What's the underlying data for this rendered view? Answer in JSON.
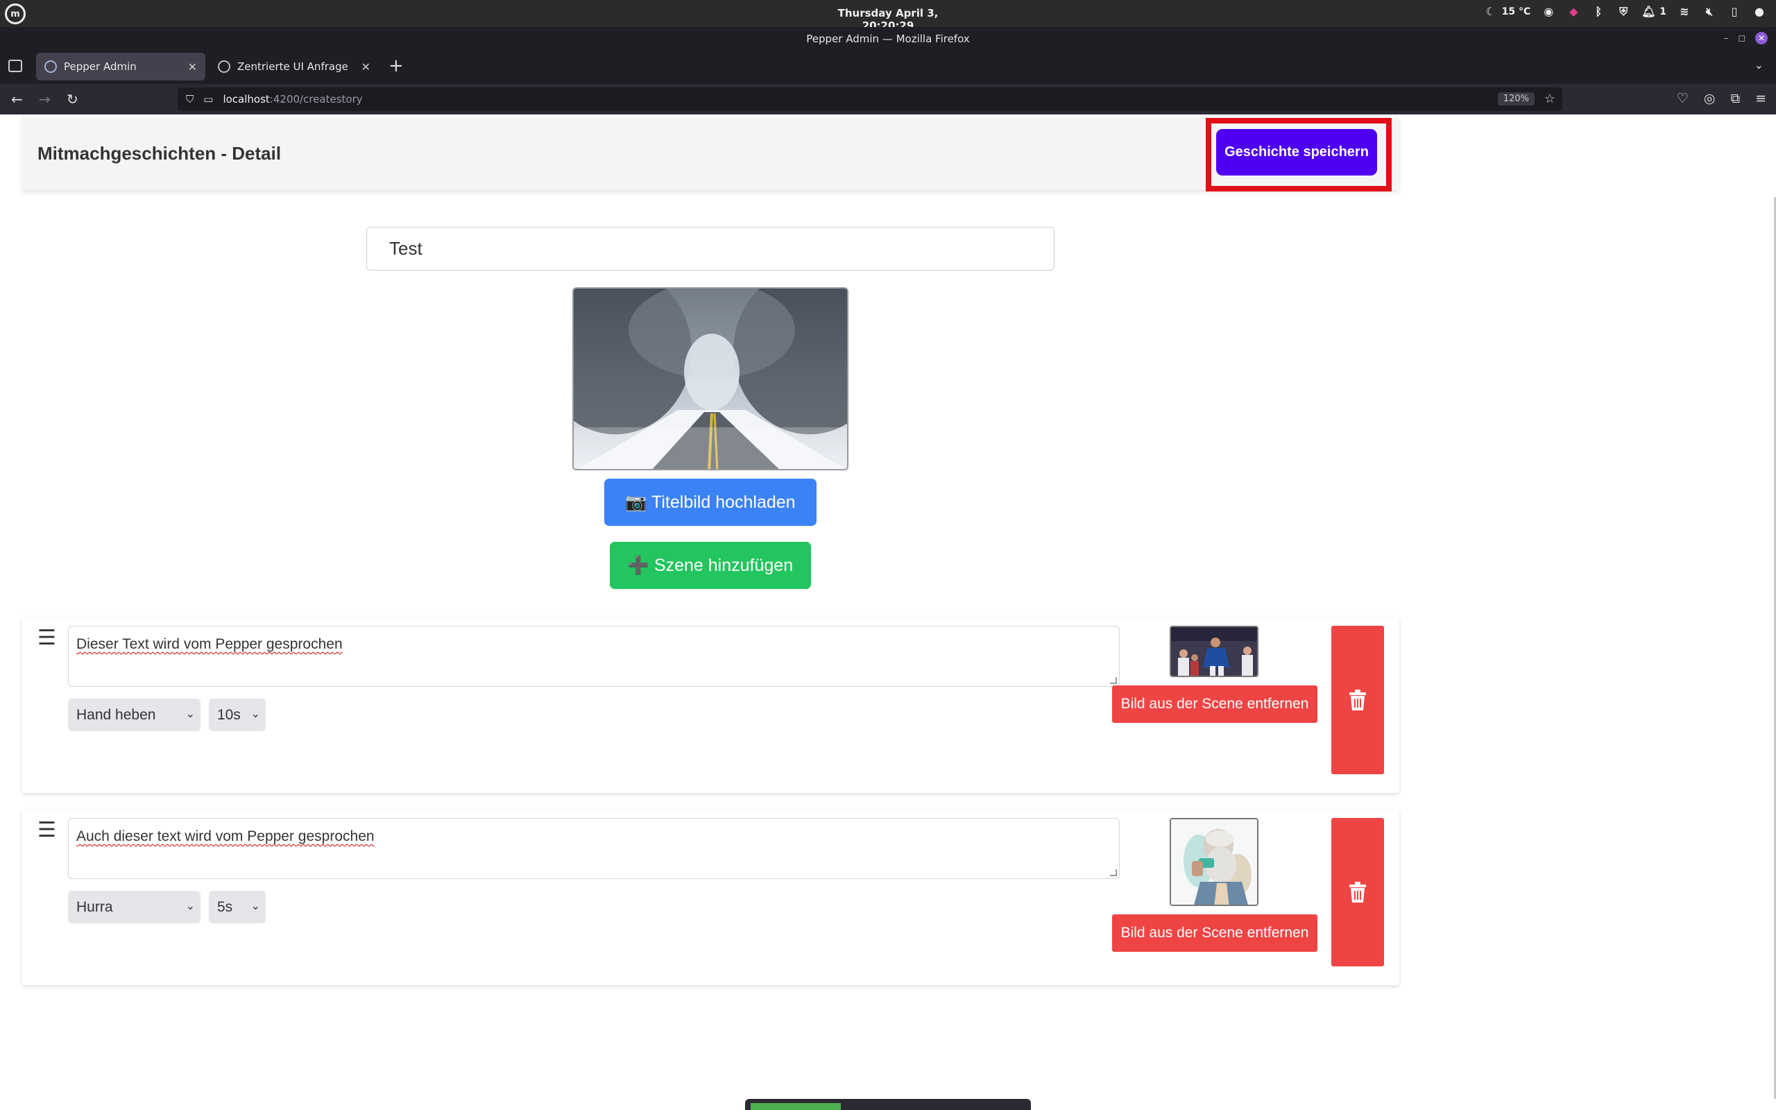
{
  "os": {
    "clock": "Thursday April 3, 20:20:29",
    "weather": "15 °C",
    "notifications": "1"
  },
  "window": {
    "title": "Pepper Admin — Mozilla Firefox"
  },
  "tabs": [
    {
      "label": "Pepper Admin",
      "active": true
    },
    {
      "label": "Zentrierte UI Anfrage",
      "active": false
    }
  ],
  "url": {
    "host": "localhost",
    "path": ":4200/createstory",
    "zoom": "120%"
  },
  "header": {
    "title": "Mitmachgeschichten - Detail",
    "save_label": "Geschichte speichern"
  },
  "story": {
    "title_value": "Test",
    "upload_label": "📷 Titelbild hochladen",
    "add_scene_label": "➕ Szene hinzufügen"
  },
  "scenes": [
    {
      "text": "Dieser Text wird vom Pepper gesprochen",
      "action": "Hand heben",
      "duration": "10s",
      "remove_image_label": "Bild aus der Scene entfernen"
    },
    {
      "text": "Auch dieser text wird vom Pepper gesprochen",
      "action": "Hurra",
      "duration": "5s",
      "remove_image_label": "Bild aus der Scene entfernen"
    }
  ],
  "colors": {
    "save_button": "#4f00f4",
    "highlight": "#e10f17",
    "upload_button": "#3b82f6",
    "add_scene_button": "#22c55e",
    "danger": "#ef4444"
  }
}
